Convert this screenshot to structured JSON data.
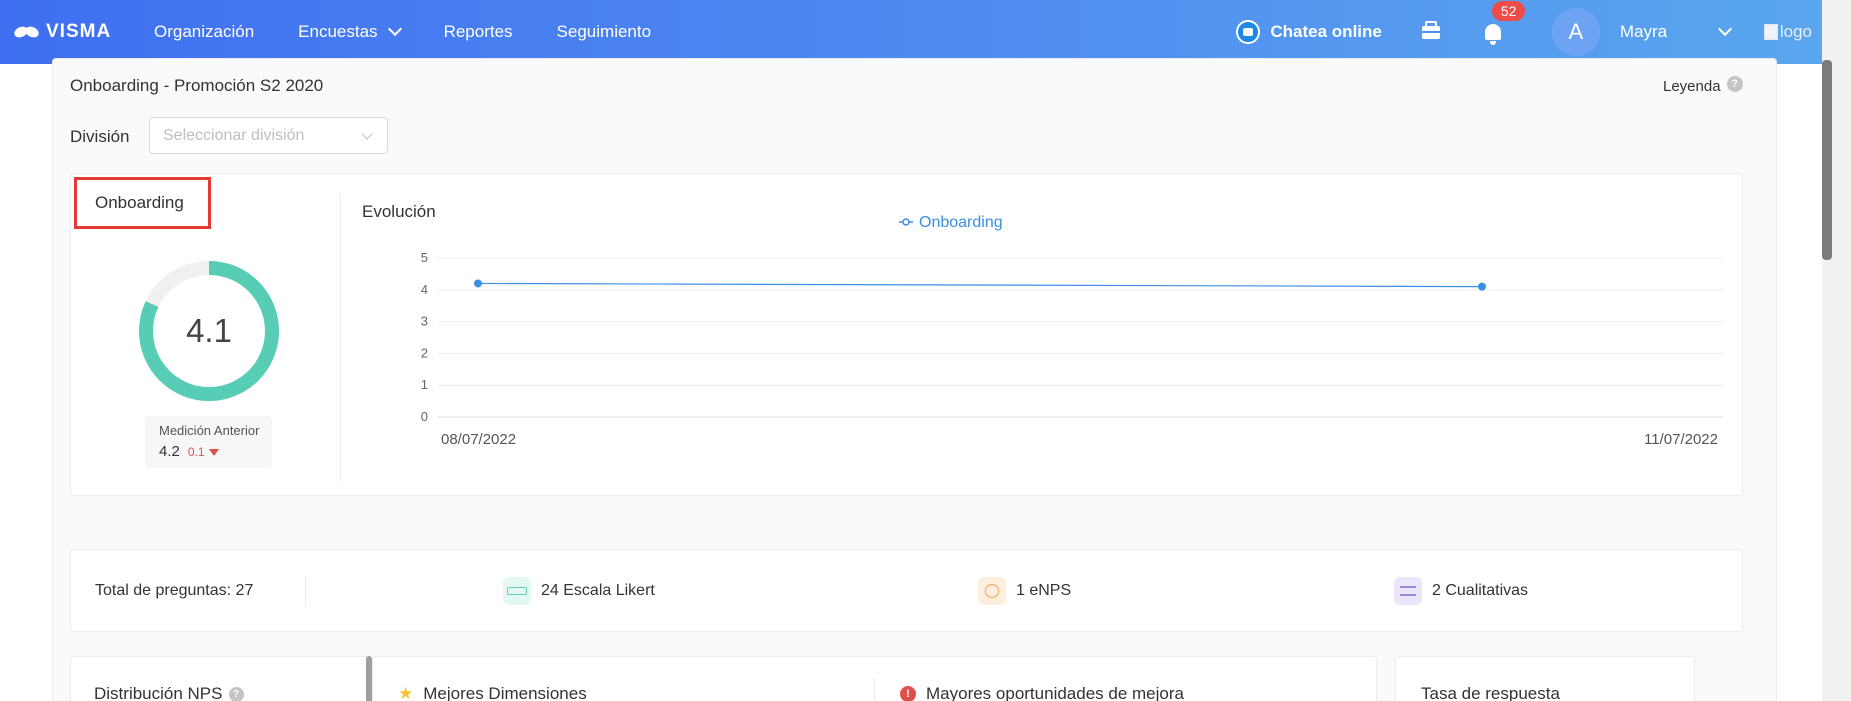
{
  "nav": {
    "logo": "VISMA",
    "items": [
      {
        "label": "Organización"
      },
      {
        "label": "Encuestas"
      },
      {
        "label": "Reportes"
      },
      {
        "label": "Seguimiento"
      }
    ],
    "chat_label": "Chatea online",
    "notification_count": "52",
    "user_initial": "A",
    "user_name": "Mayra",
    "brand_alt": "logo"
  },
  "header": {
    "title": "Onboarding - Promoción S2 2020",
    "legend_label": "Leyenda",
    "help_glyph": "?",
    "division_label": "División",
    "division_placeholder": "Seleccionar división"
  },
  "summary": {
    "title": "Onboarding",
    "score": "4.1",
    "score_fraction": 0.82,
    "previous_label": "Medición Anterior",
    "previous_value": "4.2",
    "previous_delta": "0.1",
    "accent_color": "#56cdb4",
    "track_color": "#f0f0f0",
    "delta_color": "#e0504a"
  },
  "evolution": {
    "title": "Evolución"
  },
  "chart_data": {
    "type": "line",
    "x": [
      "08/07/2022",
      "11/07/2022"
    ],
    "series": [
      {
        "name": "Onboarding",
        "values": [
          4.2,
          4.1
        ],
        "color": "#3a8ee6"
      }
    ],
    "yticks": [
      "0",
      "1",
      "2",
      "3",
      "4",
      "5"
    ],
    "ylim": [
      0,
      5
    ],
    "grid": true,
    "legend": "top-center"
  },
  "totals": {
    "label": "Total de preguntas: 27",
    "types": [
      {
        "label": "24 Escala Likert",
        "icon": "likert-icon"
      },
      {
        "label": "1 eNPS",
        "icon": "smiley-icon"
      },
      {
        "label": "2 Cualitativas",
        "icon": "text-lines-icon"
      }
    ]
  },
  "bottom": {
    "nps_title": "Distribución NPS",
    "best_title": "Mejores Dimensiones",
    "improve_title": "Mayores oportunidades de mejora",
    "alert_glyph": "!",
    "response_title": "Tasa de respuesta"
  }
}
